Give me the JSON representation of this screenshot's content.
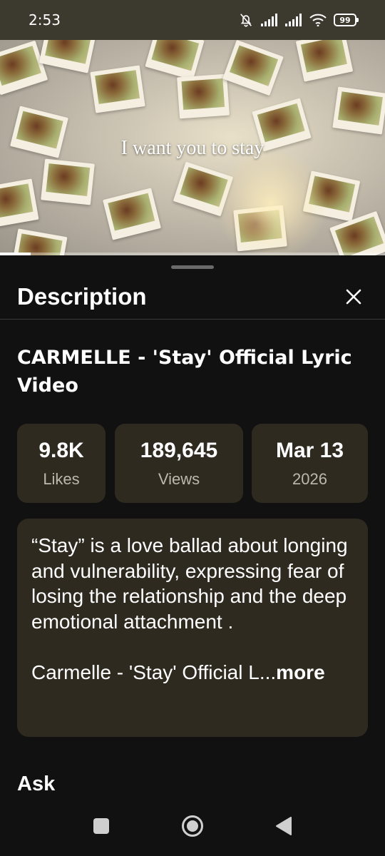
{
  "status_bar": {
    "time": "2:53",
    "battery": "99"
  },
  "video": {
    "lyric": "I want you to stay",
    "progress": 0.08
  },
  "sheet": {
    "title": "Description"
  },
  "video_info": {
    "title": "CARMELLE - 'Stay' Official Lyric Video",
    "stats": [
      {
        "value": "9.8K",
        "label": "Likes"
      },
      {
        "value": "189,645",
        "label": "Views"
      },
      {
        "value": "Mar 13",
        "label": "2026"
      }
    ],
    "description": "“Stay” is a love ballad about longing and vulnerability, expressing fear of losing the relationship and the deep emotional attachment .",
    "description_preview": "Carmelle - 'Stay' Official L...",
    "more_label": "more",
    "ask_heading": "Ask"
  },
  "icons": {
    "mute": "bell-off-icon",
    "signal": "signal-icon",
    "wifi": "wifi-icon",
    "close": "close-icon",
    "recents": "square-icon",
    "home": "circle-icon",
    "back": "triangle-back-icon"
  },
  "colors": {
    "status_bar_bg": "#3c3a2e",
    "sheet_bg": "#111111",
    "card_bg": "#2f2a20"
  }
}
